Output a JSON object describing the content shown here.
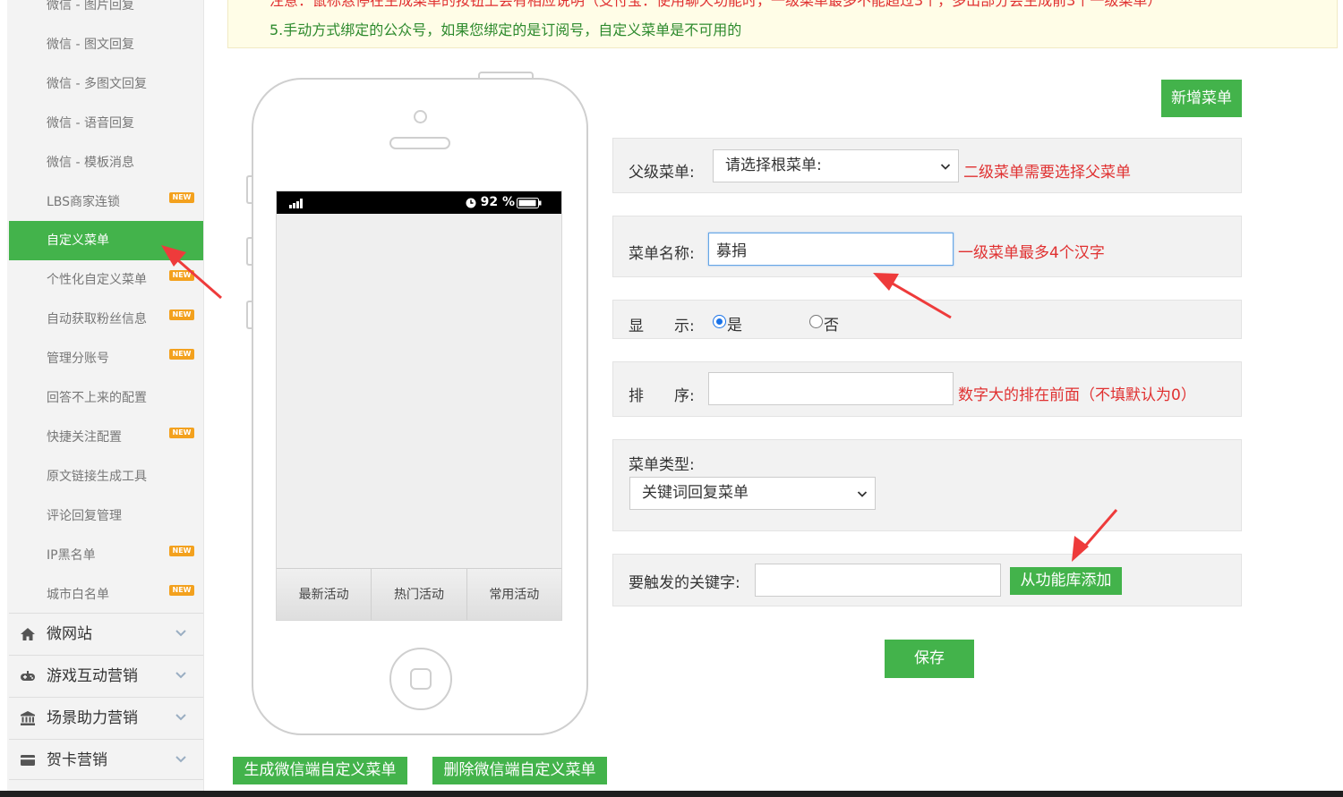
{
  "sidebar": {
    "sub_items": [
      {
        "label": "微信 - 图片回复",
        "new": false,
        "active": false
      },
      {
        "label": "微信 - 图文回复",
        "new": false,
        "active": false
      },
      {
        "label": "微信 - 多图文回复",
        "new": false,
        "active": false
      },
      {
        "label": "微信 - 语音回复",
        "new": false,
        "active": false
      },
      {
        "label": "微信 - 模板消息",
        "new": false,
        "active": false
      },
      {
        "label": "LBS商家连锁",
        "new": true,
        "active": false
      },
      {
        "label": "自定义菜单",
        "new": false,
        "active": true
      },
      {
        "label": "个性化自定义菜单",
        "new": true,
        "active": false
      },
      {
        "label": "自动获取粉丝信息",
        "new": true,
        "active": false
      },
      {
        "label": "管理分账号",
        "new": true,
        "active": false
      },
      {
        "label": "回答不上来的配置",
        "new": false,
        "active": false
      },
      {
        "label": "快捷关注配置",
        "new": true,
        "active": false
      },
      {
        "label": "原文链接生成工具",
        "new": false,
        "active": false
      },
      {
        "label": "评论回复管理",
        "new": false,
        "active": false
      },
      {
        "label": "IP黑名单",
        "new": true,
        "active": false
      },
      {
        "label": "城市白名单",
        "new": true,
        "active": false
      }
    ],
    "new_badge": "NEW",
    "groups": [
      {
        "label": "微网站",
        "icon": "home-icon"
      },
      {
        "label": "游戏互动营销",
        "icon": "gamepad-icon"
      },
      {
        "label": "场景助力营销",
        "icon": "bank-icon"
      },
      {
        "label": "贺卡营销",
        "icon": "card-icon"
      }
    ]
  },
  "notice": {
    "line1": "注意：鼠标悬停在生成菜单的按钮上会有相应说明（支付宝：使用聊天功能时，一级菜单最多不能超过3个，多出部分会生成前3个一级菜单）",
    "line2": "5.手动方式绑定的公众号，如果您绑定的是订阅号，自定义菜单是不可用的"
  },
  "phone": {
    "battery": "92 %",
    "menu_items": [
      "最新活动",
      "热门活动",
      "常用活动"
    ]
  },
  "form": {
    "add_menu_label": "新增菜单",
    "parent": {
      "label": "父级菜单:",
      "value": "请选择根菜单:",
      "hint": "二级菜单需要选择父菜单"
    },
    "name": {
      "label": "菜单名称:",
      "value": "募捐",
      "hint": "一级菜单最多4个汉字"
    },
    "display": {
      "label": "显　　示:",
      "yes": "是",
      "no": "否",
      "selected": "yes"
    },
    "order": {
      "label": "排　　序:",
      "value": "",
      "hint": "数字大的排在前面（不填默认为0）"
    },
    "type": {
      "label": "菜单类型:",
      "value": "关键词回复菜单"
    },
    "keyword": {
      "label": "要触发的关键字:",
      "value": "",
      "button": "从功能库添加"
    },
    "save_label": "保存"
  },
  "actions": {
    "generate_label": "生成微信端自定义菜单",
    "delete_label": "删除微信端自定义菜单"
  },
  "colors": {
    "accent": "#43b34b",
    "hint": "#e03131",
    "notice_green": "#2d8a2d",
    "arrow": "#ee3b3b"
  }
}
